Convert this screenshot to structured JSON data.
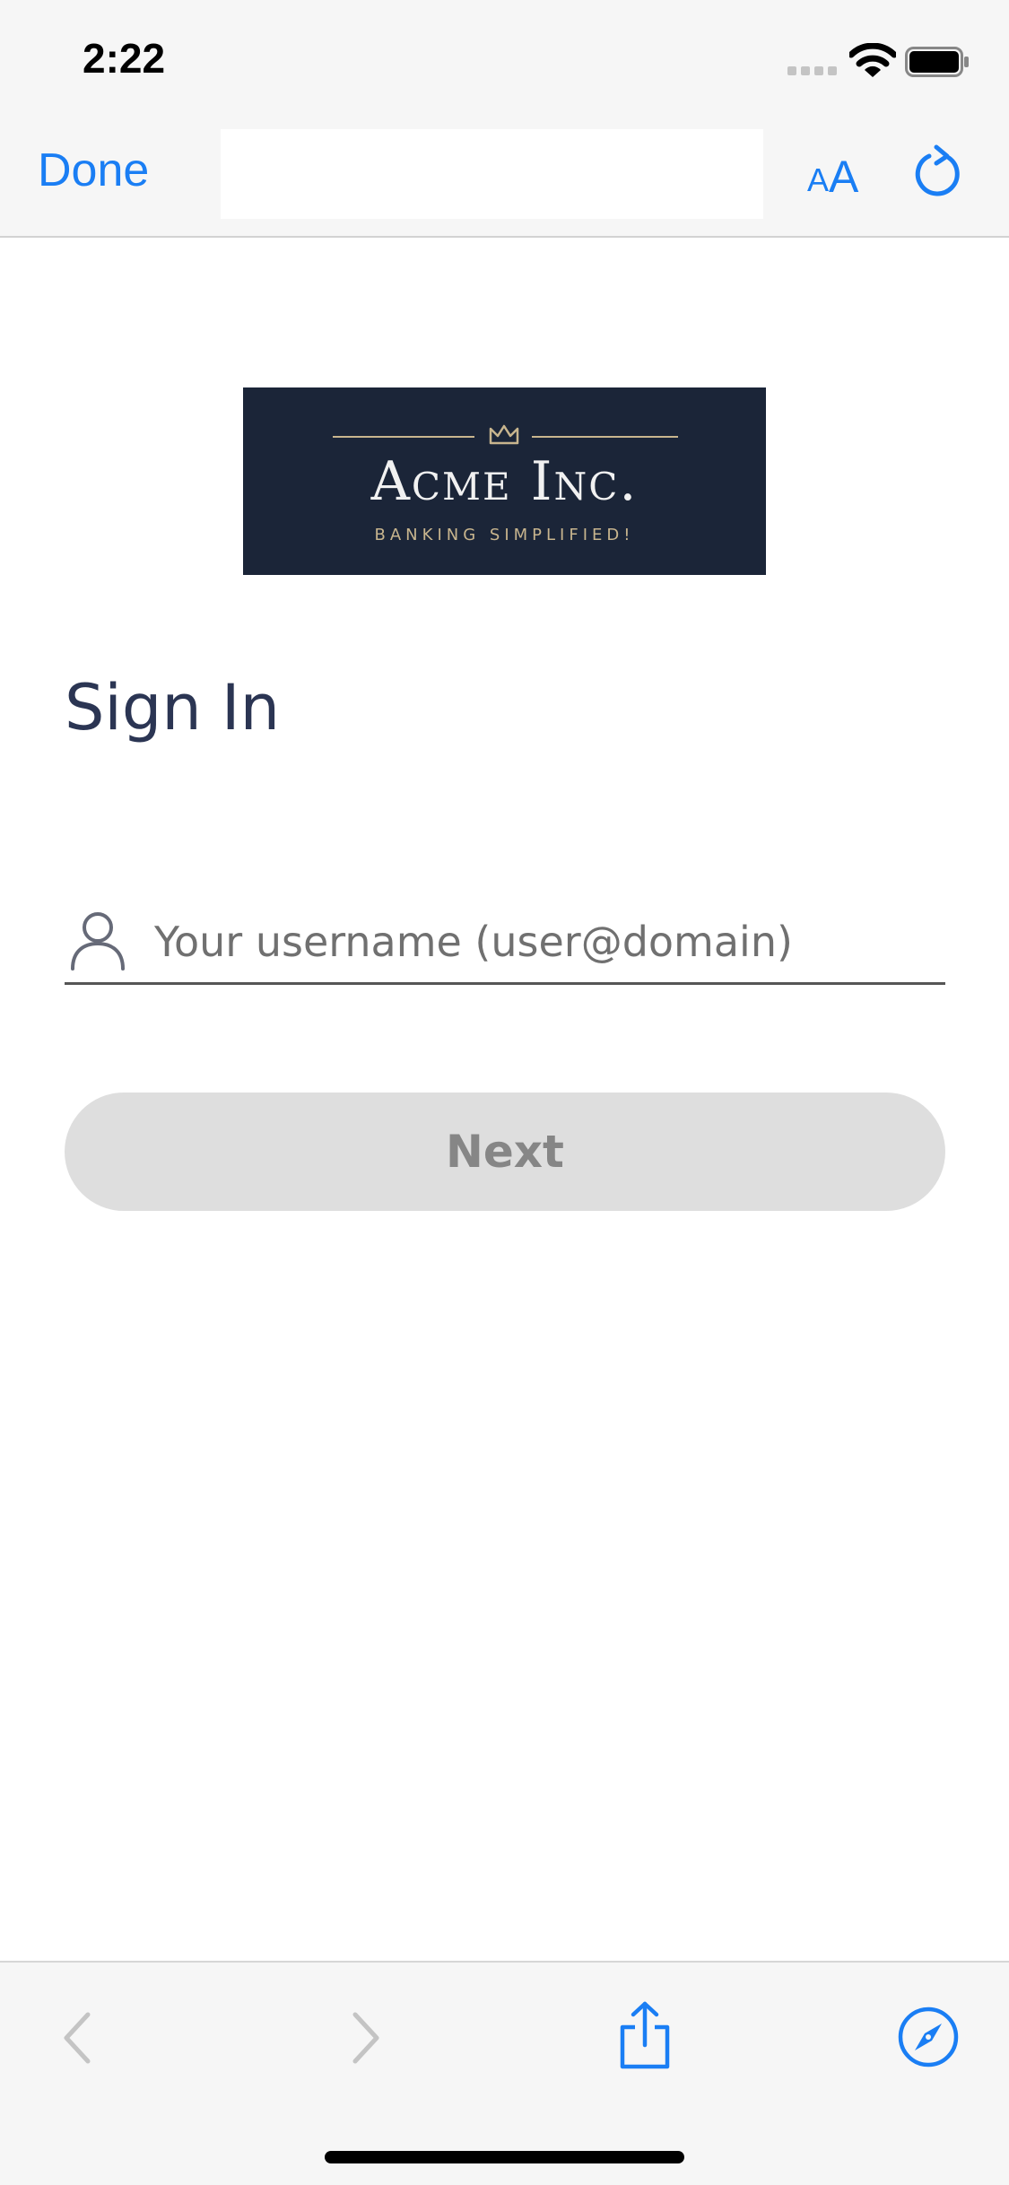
{
  "status_bar": {
    "time": "2:22",
    "icons": [
      "signal-icon",
      "wifi-icon",
      "battery-icon"
    ]
  },
  "toolbar": {
    "done_label": "Done",
    "address_value": "",
    "text_size_small": "A",
    "text_size_large": "A",
    "icons": [
      "text-size-icon",
      "reload-icon"
    ]
  },
  "logo": {
    "name": "Acme Inc.",
    "tagline": "BANKING SIMPLIFIED!",
    "icon": "crown-icon"
  },
  "sign_in": {
    "title": "Sign In",
    "username_placeholder": "Your username (user@domain)",
    "username_value": "",
    "user_icon": "user-icon",
    "next_label": "Next"
  },
  "bottom_bar": {
    "icons": [
      "back-icon",
      "forward-icon",
      "share-icon",
      "compass-icon"
    ]
  },
  "colors": {
    "accent": "#1a7ef4",
    "logo_background": "#1b2538",
    "logo_gold": "#c8b58e",
    "title_text": "#2b3553",
    "button_disabled_bg": "#dedede",
    "button_disabled_text": "#868686",
    "chrome_background": "#f6f6f6"
  }
}
